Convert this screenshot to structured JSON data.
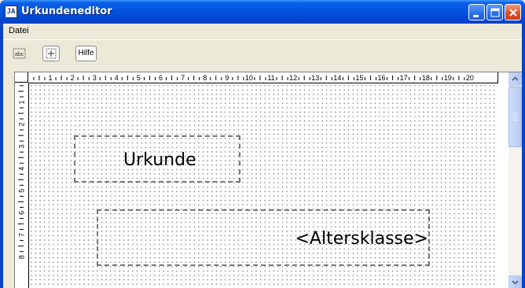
{
  "window": {
    "title": "Urkundeneditor",
    "app_icon_glyph": "JA",
    "controls": [
      "minimize",
      "maximize",
      "close"
    ]
  },
  "menu": {
    "items": [
      "Datei"
    ]
  },
  "toolbar": {
    "buttons": [
      {
        "icon": "insert-text-field-icon"
      },
      {
        "icon": "insert-image-field-icon"
      },
      {
        "label": "Hilfe"
      }
    ]
  },
  "ruler": {
    "horizontal": [
      "1",
      "2",
      "3",
      "4",
      "5",
      "6",
      "7",
      "8",
      "9",
      "10",
      "11",
      "12",
      "13",
      "14",
      "15",
      "16",
      "17",
      "18",
      "19",
      "20"
    ],
    "vertical": [
      "1",
      "2",
      "3",
      "4",
      "5",
      "6",
      "7",
      "8"
    ]
  },
  "fields": [
    {
      "text": "Urkunde"
    },
    {
      "text": "<Altersklasse>"
    }
  ],
  "colors": {
    "titlebar": "#0148d6",
    "field_border": "#777777",
    "grid_dot": "#777777"
  }
}
